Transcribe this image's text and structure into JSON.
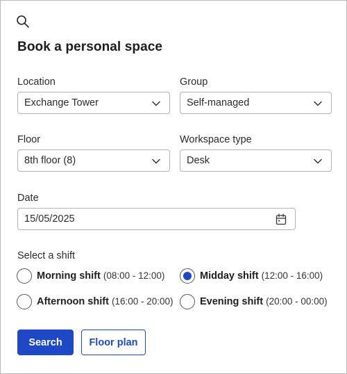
{
  "header": {
    "title": "Book a personal space"
  },
  "form": {
    "location": {
      "label": "Location",
      "value": "Exchange Tower"
    },
    "group": {
      "label": "Group",
      "value": "Self-managed"
    },
    "floor": {
      "label": "Floor",
      "value": "8th floor (8)"
    },
    "workspace_type": {
      "label": "Workspace type",
      "value": "Desk"
    },
    "date": {
      "label": "Date",
      "value": "15/05/2025"
    },
    "shift": {
      "label": "Select a shift",
      "selected": "Midday shift",
      "options": [
        {
          "name": "Morning shift",
          "time": "(08:00 - 12:00)"
        },
        {
          "name": "Midday shift",
          "time": "(12:00 - 16:00)"
        },
        {
          "name": "Afternoon shift",
          "time": "(16:00 - 20:00)"
        },
        {
          "name": "Evening shift",
          "time": "(20:00 - 00:00)"
        }
      ]
    }
  },
  "actions": {
    "search_label": "Search",
    "floor_plan_label": "Floor plan"
  },
  "colors": {
    "primary": "#1f48c7",
    "border": "#b3b3b3"
  },
  "icons": {
    "search": "search-icon",
    "chevron": "chevron-down-icon",
    "calendar": "calendar-icon"
  }
}
